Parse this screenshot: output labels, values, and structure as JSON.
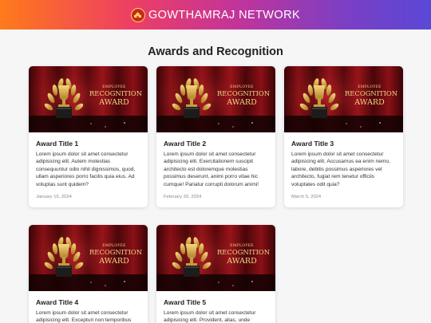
{
  "header": {
    "brand_name": "GOWTHAMRAJ NETWORK",
    "logo_icon": "temple-emblem-icon"
  },
  "main": {
    "page_title": "Awards and Recognition",
    "banner": {
      "line1": "EMPLOYEE",
      "line2": "RECOGNITION",
      "line3": "AWARD"
    },
    "awards": [
      {
        "title": "Award Title 1",
        "text": "Lorem ipsum dolor sit amet consectetur adipisicing elit. Autem molestias consequuntur odio nihil dignissimos, quod, ullam asperiores porro facilis quia eius. Ad voluptas sunt quidem?",
        "date": "January 15, 2024"
      },
      {
        "title": "Award Title 2",
        "text": "Lorem ipsum dolor sit amet consectetur adipisicing elit. Exercitationem suscipit architecto est doloremque molestias possimus deserunt, animi porro vitae hic cumque! Pariatur corrupti dolorum animi!",
        "date": "February 20, 2024"
      },
      {
        "title": "Award Title 3",
        "text": "Lorem ipsum dolor sit amet consectetur adipisicing elit. Accusamus ea enim nemo, labore, debitis possimus asperiores vel architecto, fugiat rem tenetur officiis voluptates odit quia?",
        "date": "March 5, 2024"
      },
      {
        "title": "Award Title 4",
        "text": "Lorem ipsum dolor sit amet consectetur adipisicing elit. Excepturi non temporibus",
        "date": ""
      },
      {
        "title": "Award Title 5",
        "text": "Lorem ipsum dolor sit amet consectetur adipisicing elit. Provident, alias, unde",
        "date": ""
      }
    ]
  },
  "colors": {
    "header_gradient": [
      "#ff7a1a",
      "#ee3f63",
      "#c2349a",
      "#7b3fc4",
      "#5a48d6"
    ],
    "banner_bg": "#6e0b10",
    "gold": "#e0b450"
  }
}
